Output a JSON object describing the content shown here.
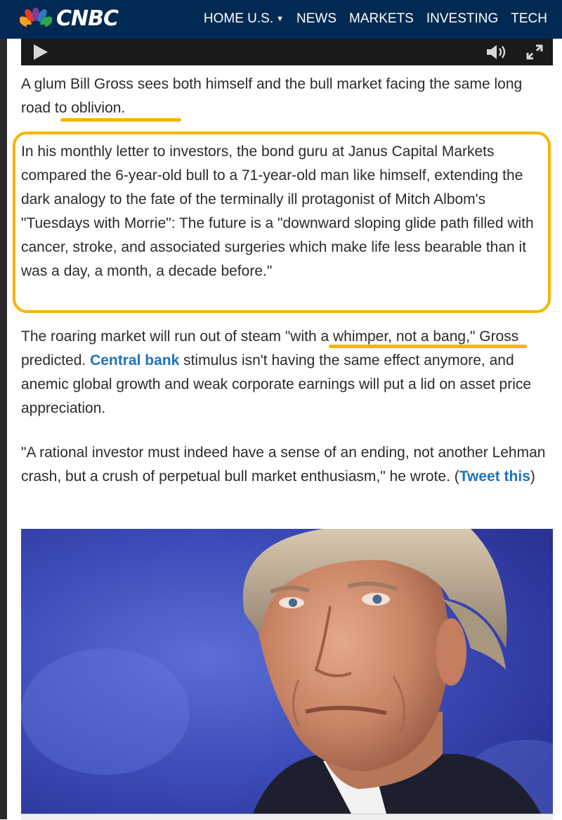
{
  "header": {
    "brand": "CNBC",
    "nav": [
      {
        "label": "HOME U.S.",
        "caret": "▼"
      },
      {
        "label": "NEWS"
      },
      {
        "label": "MARKETS"
      },
      {
        "label": "INVESTING"
      },
      {
        "label": "TECH"
      }
    ]
  },
  "article": {
    "p1": {
      "before": "A glum Bill Gross sees both himself and the bull market facing the same long ",
      "highlight": "road to oblivion."
    },
    "p2": "In his monthly letter to investors, the bond guru at Janus Capital Markets compared the 6-year-old bull to a 71-year-old man like himself, extending the dark analogy to the fate of the terminally ill protagonist of Mitch Albom's \"Tuesdays with Morrie\": The future is a \"downward sloping glide path filled with cancer, stroke, and associated surgeries which make life less bearable than it was a day, a month, a decade before.\"",
    "p3": {
      "before": "The roaring market will run out of steam \"",
      "highlight": "with a whimper, not a bang",
      "mid": ",\" Gross predicted. ",
      "link": "Central bank",
      "after": " stimulus isn't having the same effect anymore, and anemic global growth and weak corporate earnings will put a lid on asset price appreciation."
    },
    "p4": {
      "before": "\"A rational investor must indeed have a sense of an ending, not another Lehman crash, but a crush of perpetual bull market enthusiasm,\" he wrote. (",
      "link": "Tweet this",
      "after": ")"
    }
  },
  "colors": {
    "header_bg": "#002a51",
    "link": "#1d73ba",
    "highlight": "#f7b500"
  },
  "icons": [
    "play-icon",
    "volume-icon",
    "fullscreen-icon",
    "peacock-logo-icon"
  ]
}
